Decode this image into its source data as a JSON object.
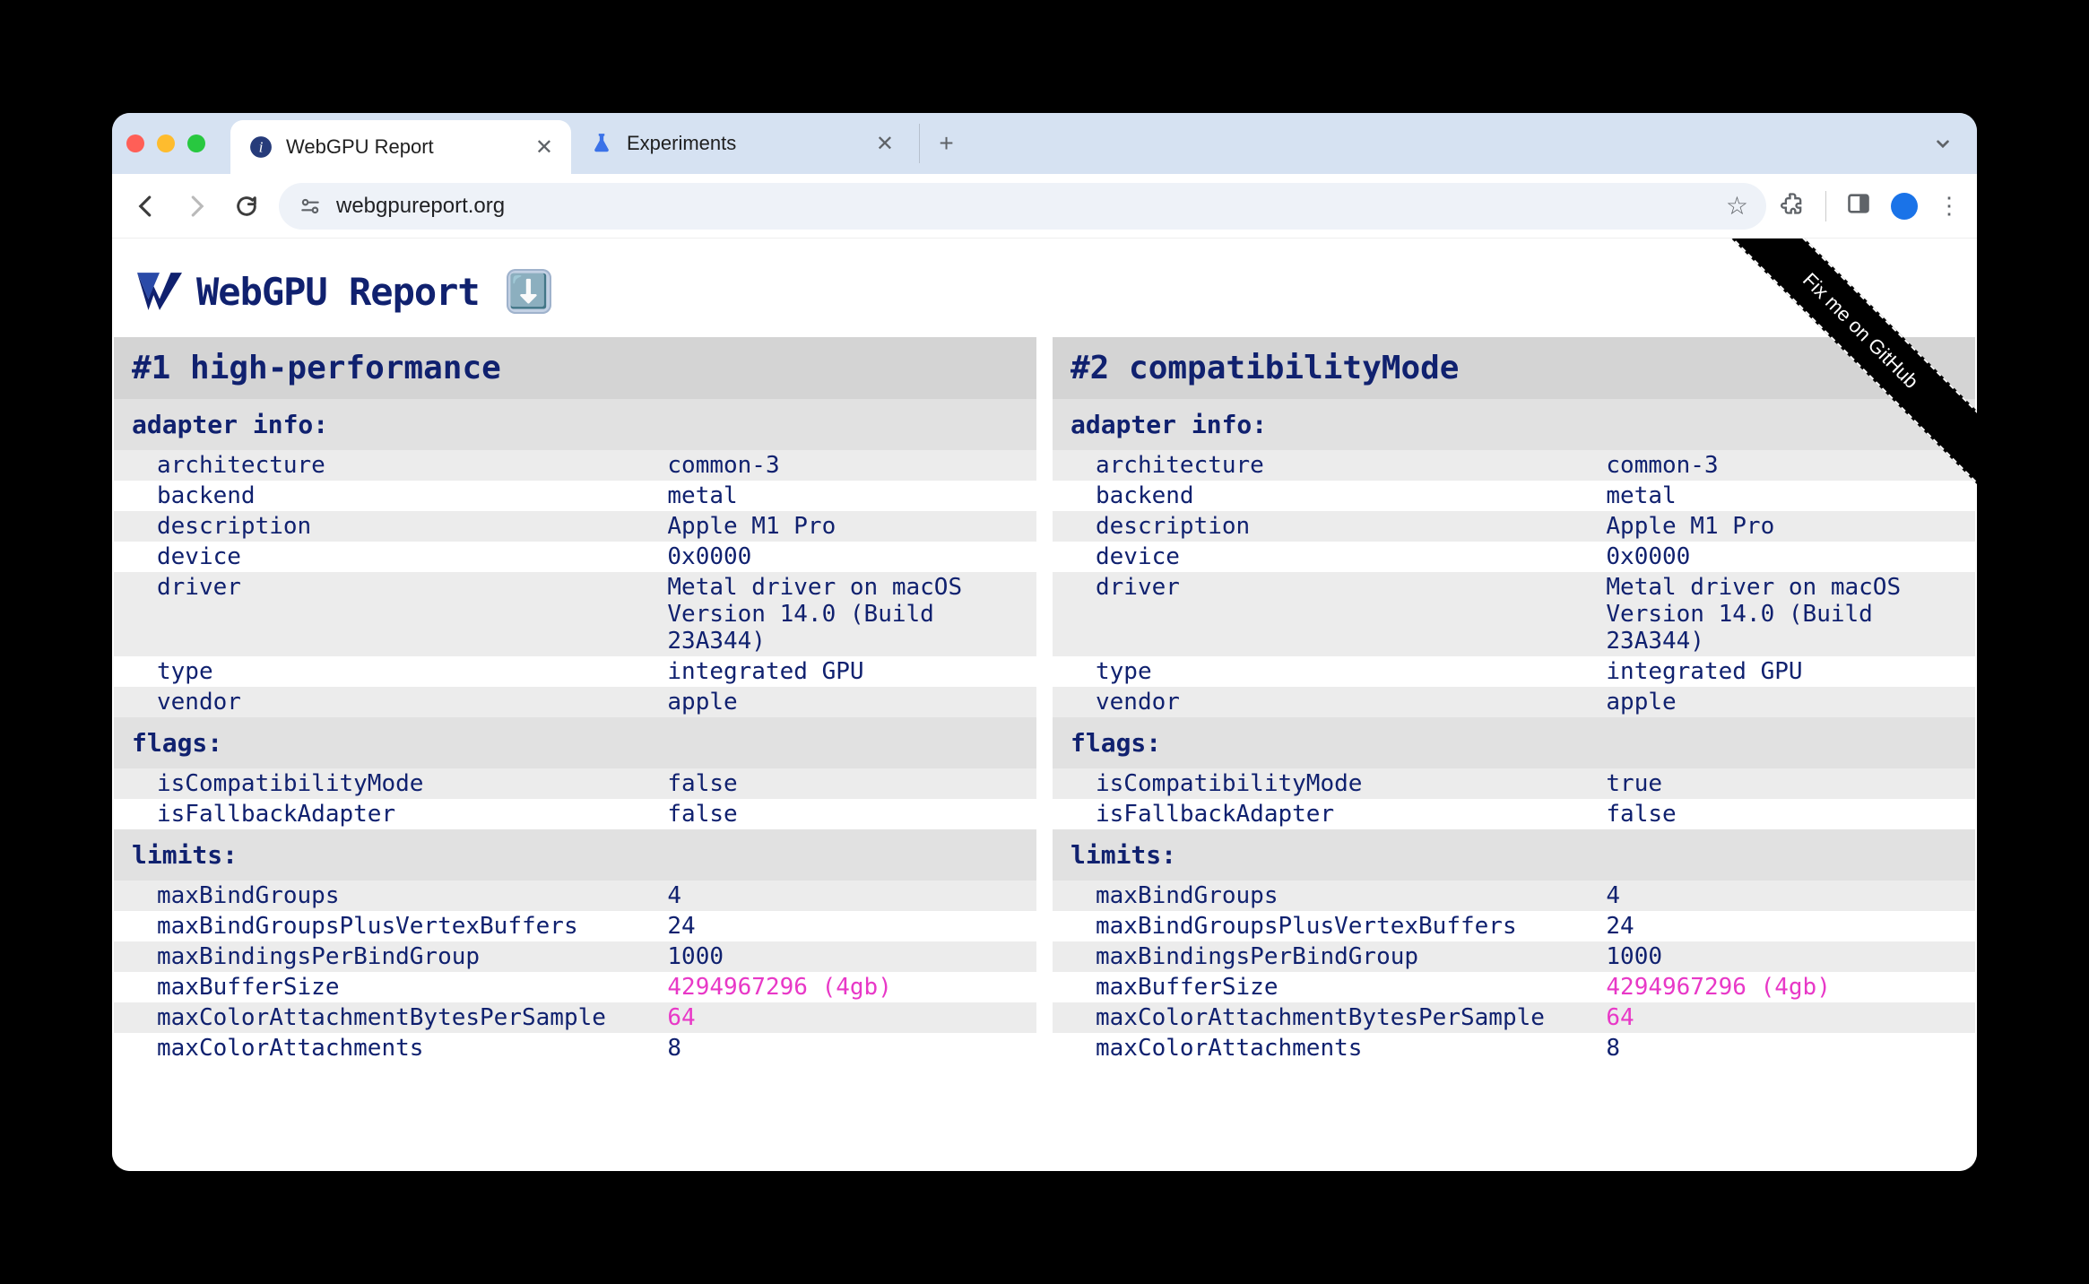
{
  "browser": {
    "tabs": [
      {
        "title": "WebGPU Report",
        "active": true,
        "favicon": "ℹ️"
      },
      {
        "title": "Experiments",
        "active": false,
        "favicon": "🧪"
      }
    ],
    "url": "webgpureport.org"
  },
  "page": {
    "title": "WebGPU Report",
    "ribbon": "Fix me on GitHub"
  },
  "adapters": [
    {
      "heading": "#1 high-performance",
      "sections": [
        {
          "title": "adapter info:",
          "rows": [
            {
              "key": "architecture",
              "val": "common-3"
            },
            {
              "key": "backend",
              "val": "metal"
            },
            {
              "key": "description",
              "val": "Apple M1 Pro"
            },
            {
              "key": "device",
              "val": "0x0000"
            },
            {
              "key": "driver",
              "val": "Metal driver on macOS Version 14.0 (Build 23A344)"
            },
            {
              "key": "type",
              "val": "integrated GPU"
            },
            {
              "key": "vendor",
              "val": "apple"
            }
          ]
        },
        {
          "title": "flags:",
          "rows": [
            {
              "key": "isCompatibilityMode",
              "val": "false"
            },
            {
              "key": "isFallbackAdapter",
              "val": "false"
            }
          ]
        },
        {
          "title": "limits:",
          "rows": [
            {
              "key": "maxBindGroups",
              "val": "4"
            },
            {
              "key": "maxBindGroupsPlusVertexBuffers",
              "val": "24"
            },
            {
              "key": "maxBindingsPerBindGroup",
              "val": "1000"
            },
            {
              "key": "maxBufferSize",
              "val": "4294967296 (4gb)",
              "pink": true
            },
            {
              "key": "maxColorAttachmentBytesPerSample",
              "val": "64",
              "pink": true
            },
            {
              "key": "maxColorAttachments",
              "val": "8"
            }
          ]
        }
      ]
    },
    {
      "heading": "#2 compatibilityMode",
      "sections": [
        {
          "title": "adapter info:",
          "rows": [
            {
              "key": "architecture",
              "val": "common-3"
            },
            {
              "key": "backend",
              "val": "metal"
            },
            {
              "key": "description",
              "val": "Apple M1 Pro"
            },
            {
              "key": "device",
              "val": "0x0000"
            },
            {
              "key": "driver",
              "val": "Metal driver on macOS Version 14.0 (Build 23A344)"
            },
            {
              "key": "type",
              "val": "integrated GPU"
            },
            {
              "key": "vendor",
              "val": "apple"
            }
          ]
        },
        {
          "title": "flags:",
          "rows": [
            {
              "key": "isCompatibilityMode",
              "val": "true"
            },
            {
              "key": "isFallbackAdapter",
              "val": "false"
            }
          ]
        },
        {
          "title": "limits:",
          "rows": [
            {
              "key": "maxBindGroups",
              "val": "4"
            },
            {
              "key": "maxBindGroupsPlusVertexBuffers",
              "val": "24"
            },
            {
              "key": "maxBindingsPerBindGroup",
              "val": "1000"
            },
            {
              "key": "maxBufferSize",
              "val": "4294967296 (4gb)",
              "pink": true
            },
            {
              "key": "maxColorAttachmentBytesPerSample",
              "val": "64",
              "pink": true
            },
            {
              "key": "maxColorAttachments",
              "val": "8"
            }
          ]
        }
      ]
    }
  ]
}
